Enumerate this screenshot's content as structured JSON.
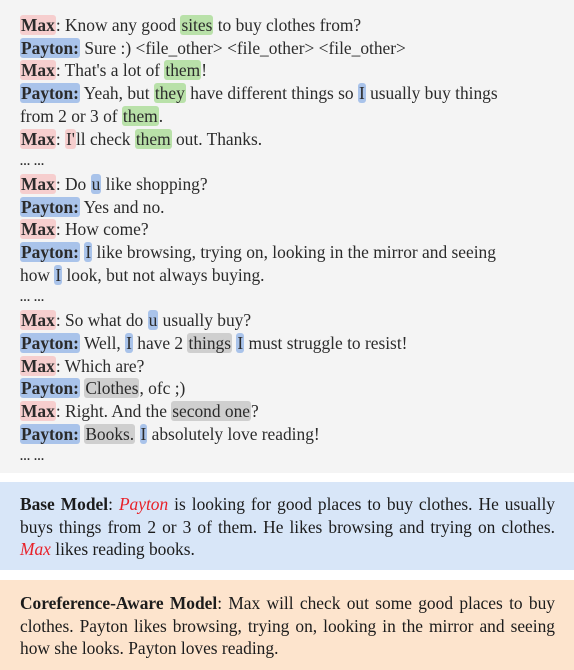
{
  "colors": {
    "dialog_bg": "#f4f4f4",
    "max_speaker": "#f6cece",
    "payton_speaker": "#a9c3ea",
    "coref_green": "#b9e1a9",
    "coref_blue": "#a9c3ea",
    "coref_gray": "#cfcfcf",
    "base_model_bg": "#d8e6f8",
    "coref_model_bg": "#fde4cd",
    "error_red": "#e8222a"
  },
  "dialogue": {
    "speakers": {
      "max": "Max",
      "payton": "Payton"
    },
    "ellipsis": "... ...",
    "turns": [
      {
        "parts": [
          "Max",
          ": Know any good ",
          "sites",
          " to buy clothes from?"
        ]
      },
      {
        "parts": [
          "Payton:",
          " Sure :) <file_other> <file_other> <file_other>"
        ]
      },
      {
        "parts": [
          "Max",
          ": That's a lot of ",
          "them",
          "!"
        ]
      },
      {
        "parts": [
          "Payton:",
          " Yeah, but ",
          "they",
          " have different things so ",
          "I",
          " usually buy things from 2 or 3 of ",
          "them",
          "."
        ]
      },
      {
        "parts": [
          "Max",
          ": ",
          "I'",
          "ll check ",
          "them",
          " out. Thanks."
        ]
      },
      {
        "parts": [
          "Max",
          ": Do ",
          "u",
          " like shopping?"
        ]
      },
      {
        "parts": [
          "Payton:",
          " Yes and no."
        ]
      },
      {
        "parts": [
          "Max",
          ": How come?"
        ]
      },
      {
        "parts": [
          "Payton:",
          " ",
          "I",
          " like browsing, trying on, looking in the mirror and seeing how ",
          "I",
          " look, but not always buying."
        ]
      },
      {
        "parts": [
          "Max",
          ": So what do ",
          "u",
          " usually buy?"
        ]
      },
      {
        "parts": [
          "Payton:",
          " Well, ",
          "I",
          " have 2 ",
          "things",
          " ",
          "I",
          " must struggle to resist!"
        ]
      },
      {
        "parts": [
          "Max",
          ": Which are?"
        ]
      },
      {
        "parts": [
          "Payton:",
          " ",
          "Clothes",
          ", ofc ;)"
        ]
      },
      {
        "parts": [
          "Max",
          ": Right. And the ",
          "second one",
          "?"
        ]
      },
      {
        "parts": [
          "Payton:",
          " ",
          "Books.",
          " ",
          "I",
          " absolutely love reading!"
        ]
      }
    ]
  },
  "base_model": {
    "label": "Base Model",
    "colon": ": ",
    "name1": "Payton",
    "text1": " is looking for good places to buy clothes. He usually buys things from 2 or 3 of them. He likes browsing and trying on clothes. ",
    "name2": "Max",
    "text2": " likes reading books."
  },
  "coref_model": {
    "label": "Coreference-Aware Model",
    "colon": ": ",
    "text": "Max will check out some good places to buy clothes. Payton likes browsing, trying on, looking in the mirror and seeing how she looks. Payton loves reading."
  }
}
